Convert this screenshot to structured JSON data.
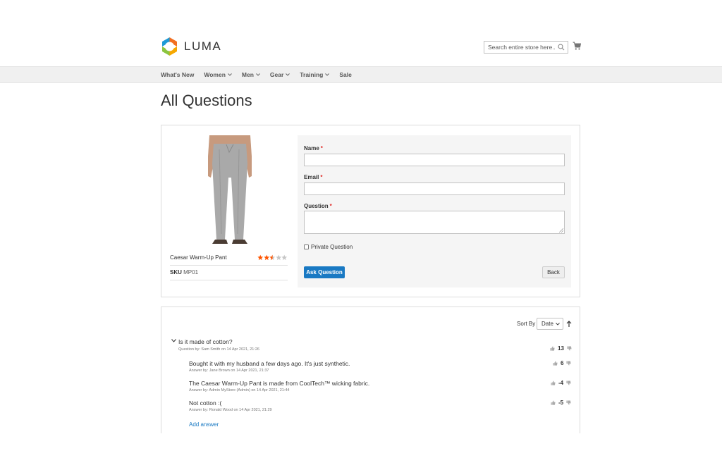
{
  "brand": {
    "name": "LUMA"
  },
  "search": {
    "placeholder": "Search entire store here..."
  },
  "nav": {
    "items": [
      "What's New",
      "Women",
      "Men",
      "Gear",
      "Training",
      "Sale"
    ]
  },
  "page": {
    "title": "All Questions"
  },
  "product": {
    "name": "Caesar Warm-Up Pant",
    "rating": 2.5,
    "rating_max": 5,
    "sku_label": "SKU",
    "sku_value": "MP01"
  },
  "form": {
    "name_label": "Name",
    "email_label": "Email",
    "question_label": "Question",
    "required_mark": "*",
    "private_label": "Private Question",
    "ask_button": "Ask Question",
    "back_button": "Back"
  },
  "sort": {
    "label": "Sort By",
    "value": "Date"
  },
  "question": {
    "text": "Is it made of cotton?",
    "meta": "Question by: Sam Smith on 14 Apr 2021, 21:26",
    "votes": "13"
  },
  "answers": [
    {
      "text": "Bought it with my husband a few days ago. It's just synthetic.",
      "meta": "Answer by: Jane Brown on 14 Apr 2021, 21:37",
      "votes": "6"
    },
    {
      "text": "The Caesar Warm-Up Pant is made from CoolTech™ wicking fabric.",
      "meta": "Answer by: Admin MyStore (Admin) on 14 Apr 2021, 21:44",
      "votes": "-4"
    },
    {
      "text": "Not cotton :(",
      "meta": "Answer by: Ronald Wood on 14 Apr 2021, 21:29",
      "votes": "-5"
    }
  ],
  "add_answer": "Add answer",
  "colors": {
    "accent": "#1979c3",
    "star_on": "#ff5501",
    "star_off": "#c7c7c7",
    "required": "#e02b27"
  }
}
